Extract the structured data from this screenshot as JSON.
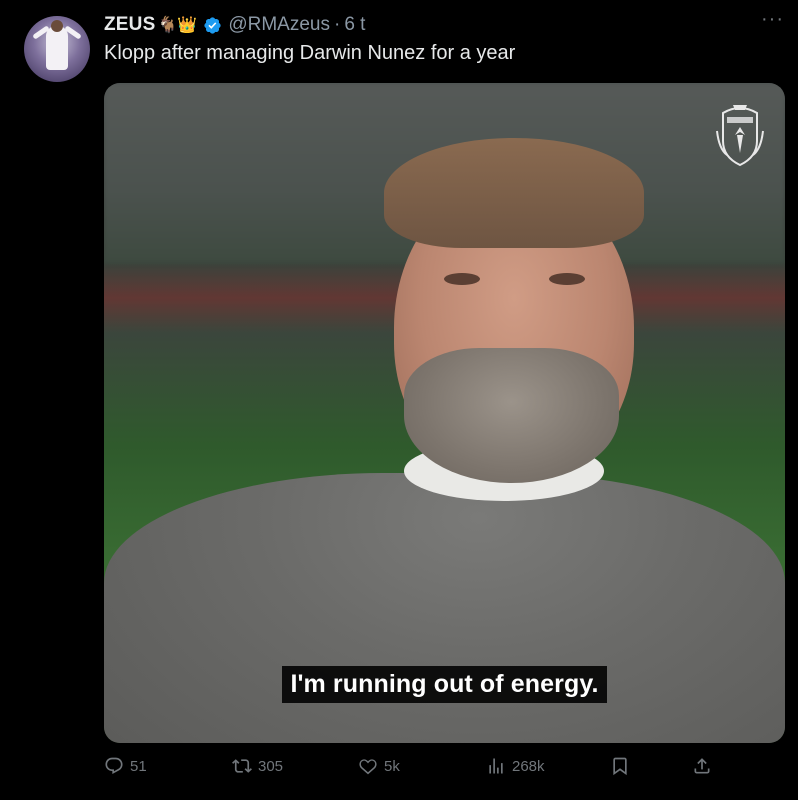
{
  "tweet": {
    "author_name": "ZEUS",
    "author_emojis": "🐐👑",
    "handle": "@RMAzeus",
    "time": "6 t",
    "text": "Klopp after managing Darwin Nunez for a year"
  },
  "media": {
    "subtitle": "I'm running out of energy.",
    "crest_icon": "liverpool-crest-icon"
  },
  "actions": {
    "replies": "51",
    "reposts": "305",
    "likes": "5k",
    "views": "268k"
  },
  "colors": {
    "background": "#000000",
    "text": "#e7e9ea",
    "muted": "#71767b",
    "verified": "#1d9bf0"
  }
}
